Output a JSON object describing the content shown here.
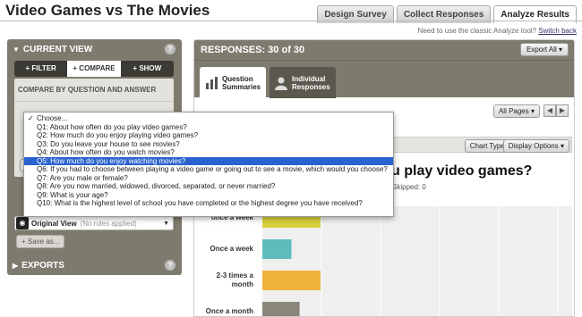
{
  "page": {
    "title": "Video Games vs The Movies"
  },
  "top_tabs": [
    "Design Survey",
    "Collect Responses",
    "Analyze Results"
  ],
  "classic_notice": {
    "text": "Need to use the classic Analyze tool?",
    "link": "Switch back"
  },
  "left_panel": {
    "header": "CURRENT VIEW",
    "help": "?",
    "segments": [
      "+ FILTER",
      "+ COMPARE",
      "+ SHOW"
    ],
    "compare_title": "COMPARE BY QUESTION AND ANSWER",
    "view_selector": {
      "name": "Original View",
      "note": "(No rules applied)"
    },
    "save_as": "+ Save as...",
    "exports": "EXPORTS"
  },
  "right_panel": {
    "responses": "RESPONSES: 30 of 30",
    "export_all": "Export All",
    "tabs": [
      "Question Summaries",
      "Individual Responses"
    ],
    "pages_button": "All Pages",
    "chart_type": "Chart Type",
    "display_options": "Display Options",
    "question_title_visible": "u play video games?",
    "meta": "Skipped: 0"
  },
  "dropdown": {
    "checked_option": "Choose...",
    "selected_index": 6,
    "options": [
      "Choose...",
      "Q1: About how often do you play video games?",
      "Q2: How much do you enjoy playing video games?",
      "Q3: Do you leave your house to see movies?",
      "Q4: About how often do you watch movies?",
      "Q5: How much do you enjoy watching movies?",
      "Q6: If you had to choose between playing a video game or going out to see a movie, which would you choose?",
      "Q7: Are you male or female?",
      "Q8: Are you now married, widowed, divorced, separated, or never married?",
      "Q9: What is your age?",
      "Q10: What is the highest level of school you have completed or the highest degree you have received?"
    ]
  },
  "chart_data": {
    "type": "bar",
    "orientation": "horizontal",
    "categories": [
      "once a week",
      "Once a week",
      "2-3 times a month",
      "Once a month"
    ],
    "values": [
      5,
      2.5,
      5,
      3.2
    ],
    "colors": [
      "#d9d23a",
      "#5fbcbc",
      "#efb13c",
      "#8a877a"
    ],
    "grid": true
  }
}
